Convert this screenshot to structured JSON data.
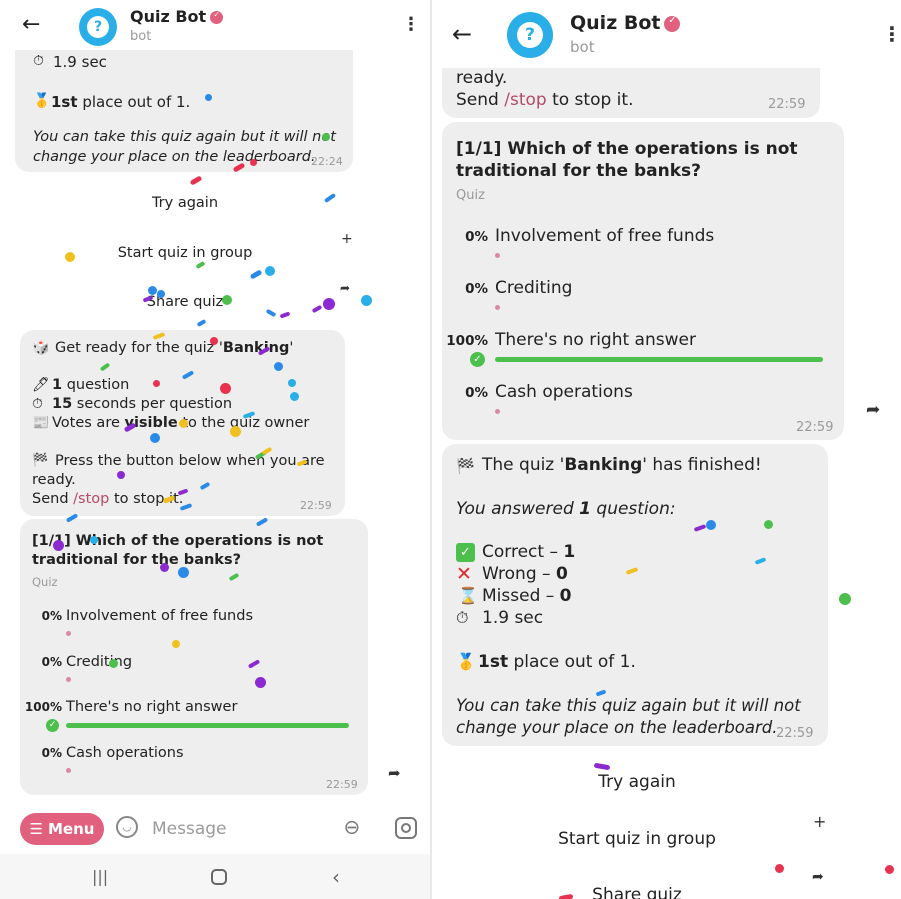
{
  "header": {
    "title": "Quiz Bot",
    "subtitle": "bot"
  },
  "left": {
    "top_bubble": {
      "time_line": "1.9 sec",
      "place_bold": "1st",
      "place_rest": " place out of 1.",
      "note_line1": "You can take this quiz again but it will not",
      "note_line2": "change your place on the leaderboard.",
      "time": "22:24"
    },
    "keyboard": {
      "try_again": "Try again",
      "start_group": "Start quiz in group",
      "share": "Share quiz"
    },
    "intro": {
      "l1_a": "Get ready for the quiz '",
      "l1_b": "Banking",
      "l1_c": "'",
      "l2_b": "1",
      "l2_a": " question",
      "l3_b": "15",
      "l3_a": " seconds per question",
      "l4_a": "Votes are ",
      "l4_b": "visible",
      "l4_c": " to the quiz owner",
      "l5": "Press the button below when you are",
      "l6": "ready.",
      "l7_a": "Send ",
      "l7_b": "/stop",
      "l7_c": " to stop it.",
      "time": "22:59"
    },
    "poll": {
      "q1": "[1/1] Which of the operations is not",
      "q2": "traditional for the banks?",
      "type": "Quiz",
      "opt1_pct": "0%",
      "opt1": "Involvement of free funds",
      "opt2_pct": "0%",
      "opt2": "Crediting",
      "opt3_pct": "100%",
      "opt3": "There's no right answer",
      "opt4_pct": "0%",
      "opt4": "Cash operations",
      "time": "22:59"
    },
    "input": {
      "menu": "Menu",
      "placeholder": "Message"
    }
  },
  "right": {
    "intro_tail": {
      "l1": "ready.",
      "l2_a": "Send ",
      "l2_b": "/stop",
      "l2_c": " to stop it.",
      "time": "22:59"
    },
    "poll": {
      "q1": "[1/1] Which of the operations is not",
      "q2": "traditional for the banks?",
      "type": "Quiz",
      "opt1_pct": "0%",
      "opt1": "Involvement of free funds",
      "opt2_pct": "0%",
      "opt2": "Crediting",
      "opt3_pct": "100%",
      "opt3": "There's no right answer",
      "opt4_pct": "0%",
      "opt4": "Cash operations",
      "time": "22:59"
    },
    "result": {
      "l1_a": "The quiz '",
      "l1_b": "Banking",
      "l1_c": "' has finished!",
      "l2_a": "You answered ",
      "l2_b": "1",
      "l2_c": " question:",
      "correct_a": "Correct – ",
      "correct_b": "1",
      "wrong_a": "Wrong – ",
      "wrong_b": "0",
      "missed_a": "Missed – ",
      "missed_b": "0",
      "time_line": "1.9 sec",
      "place_bold": "1st",
      "place_rest": " place out of 1.",
      "note_line1": "You can take this quiz again but it will not",
      "note_line2": "change your place on the leaderboard.",
      "time": "22:59"
    },
    "keyboard": {
      "try_again": "Try again",
      "start_group": "Start quiz in group",
      "share": "Share quiz"
    }
  },
  "colors": {
    "accent": "#e0607e",
    "bubble": "#eeeeee",
    "bar": "#4cbf4c",
    "avatar": "#2aaee8",
    "command": "#b44b6b"
  },
  "icons": [
    "back-arrow-icon",
    "verified-icon",
    "more-vertical-icon",
    "forward-icon",
    "plus-icon",
    "emoji-icon",
    "attach-icon",
    "camera-icon",
    "check-icon"
  ]
}
